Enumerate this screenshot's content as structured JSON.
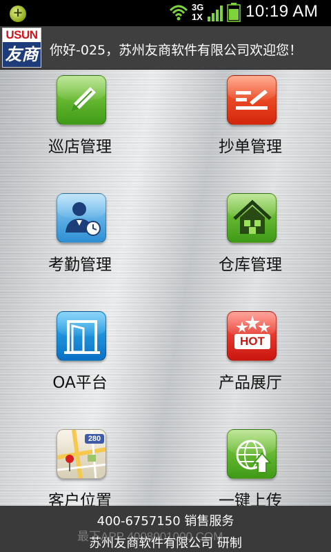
{
  "status_bar": {
    "network_type_top": "3G",
    "network_type_bottom": "1X",
    "time": "10:19 AM",
    "icons": [
      "app-notification-icon",
      "wifi-icon",
      "signal-icon",
      "battery-icon"
    ]
  },
  "header": {
    "logo_top": "USUN",
    "logo_bottom": "友商",
    "welcome": "你好-025，苏州友商软件有限公司欢迎您！"
  },
  "menu": {
    "items": [
      {
        "label": "巡店管理",
        "icon": "pencil-icon"
      },
      {
        "label": "抄单管理",
        "icon": "order-list-icon"
      },
      {
        "label": "考勤管理",
        "icon": "attendance-user-clock-icon"
      },
      {
        "label": "仓库管理",
        "icon": "warehouse-house-icon"
      },
      {
        "label": "OA平台",
        "icon": "door-icon"
      },
      {
        "label": "产品展厅",
        "icon": "hot-stars-icon"
      },
      {
        "label": "客户位置",
        "icon": "map-pin-icon"
      },
      {
        "label": "一键上传",
        "icon": "globe-upload-icon"
      }
    ],
    "map_badge": "280"
  },
  "footer": {
    "line1": "400-6757150 销售服务",
    "line2": "苏州友商软件有限公司 研制"
  },
  "watermark": "最下APP  4008001000.COM",
  "colors": {
    "status_bar": "#000000",
    "header": "#3f3f3f",
    "footer": "#3a3a3a"
  }
}
